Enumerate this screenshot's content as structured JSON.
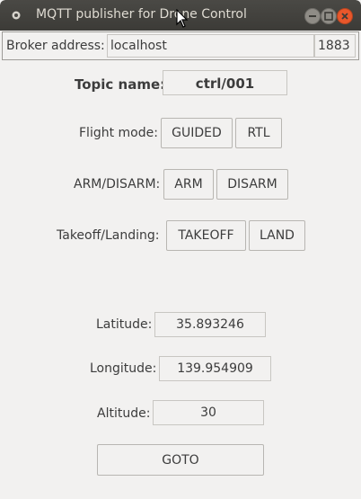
{
  "window": {
    "title": "MQTT publisher for Drone Control"
  },
  "broker": {
    "label": "Broker address:",
    "host": "localhost",
    "port": "1883"
  },
  "topic": {
    "label": "Topic name:",
    "value": "ctrl/001"
  },
  "flight_mode": {
    "label": "Flight mode:",
    "buttons": [
      "GUIDED",
      "RTL"
    ]
  },
  "arm": {
    "label": "ARM/DISARM:",
    "buttons": [
      "ARM",
      "DISARM"
    ]
  },
  "takeoff": {
    "label": "Takeoff/Landing:",
    "buttons": [
      "TAKEOFF",
      "LAND"
    ]
  },
  "latitude": {
    "label": "Latitude:",
    "value": "35.893246"
  },
  "longitude": {
    "label": "Longitude:",
    "value": "139.954909"
  },
  "altitude": {
    "label": "Altitude:",
    "value": "30"
  },
  "goto_button": "GOTO",
  "icons": {
    "app": "app-icon",
    "minimize": "minimize-icon",
    "maximize": "maximize-icon",
    "close": "close-icon",
    "cursor": "cursor-icon"
  }
}
